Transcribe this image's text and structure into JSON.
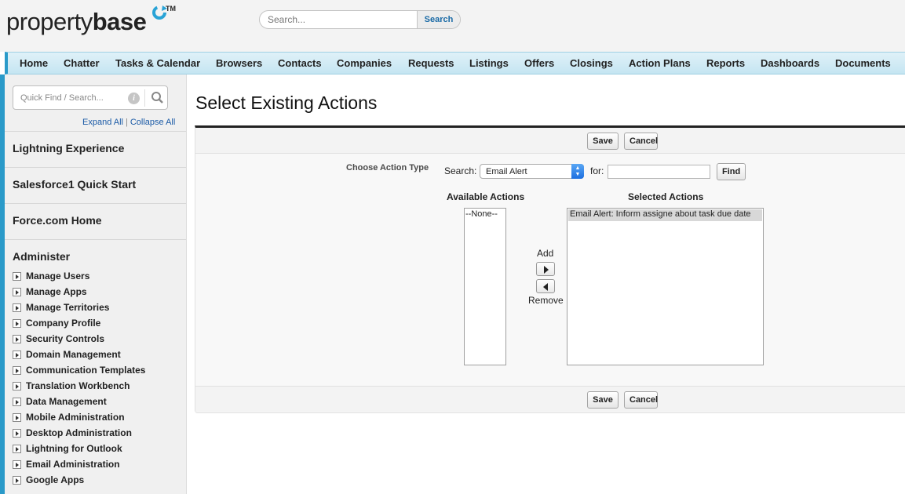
{
  "header": {
    "logo_text_light": "property",
    "logo_text_bold": "base",
    "logo_tm": "TM",
    "search_placeholder": "Search...",
    "search_button": "Search"
  },
  "tabs": [
    "Home",
    "Chatter",
    "Tasks & Calendar",
    "Browsers",
    "Contacts",
    "Companies",
    "Requests",
    "Listings",
    "Offers",
    "Closings",
    "Action Plans",
    "Reports",
    "Dashboards",
    "Documents"
  ],
  "sidebar": {
    "quick_find_placeholder": "Quick Find / Search...",
    "expand_all": "Expand All",
    "collapse_all": "Collapse All",
    "sections": [
      "Lightning Experience",
      "Salesforce1 Quick Start",
      "Force.com Home",
      "Administer"
    ],
    "administer_items": [
      "Manage Users",
      "Manage Apps",
      "Manage Territories",
      "Company Profile",
      "Security Controls",
      "Domain Management",
      "Communication Templates",
      "Translation Workbench",
      "Data Management",
      "Mobile Administration",
      "Desktop Administration",
      "Lightning for Outlook",
      "Email Administration",
      "Google Apps"
    ]
  },
  "main": {
    "title": "Select Existing Actions",
    "save_label": "Save",
    "cancel_label": "Cancel",
    "choose_action_type": "Choose Action Type",
    "search_label": "Search:",
    "search_select_value": "Email Alert",
    "for_label": "for:",
    "for_value": "",
    "find_label": "Find",
    "available_heading": "Available Actions",
    "selected_heading": "Selected Actions",
    "available_options": [
      "--None--"
    ],
    "selected_options": [
      "Email Alert: Inform assigne about task due date"
    ],
    "add_label": "Add",
    "remove_label": "Remove"
  },
  "colors": {
    "accent": "#2a9ac9",
    "link": "#1a5aa6",
    "tabbar": "#c5e5f2"
  }
}
